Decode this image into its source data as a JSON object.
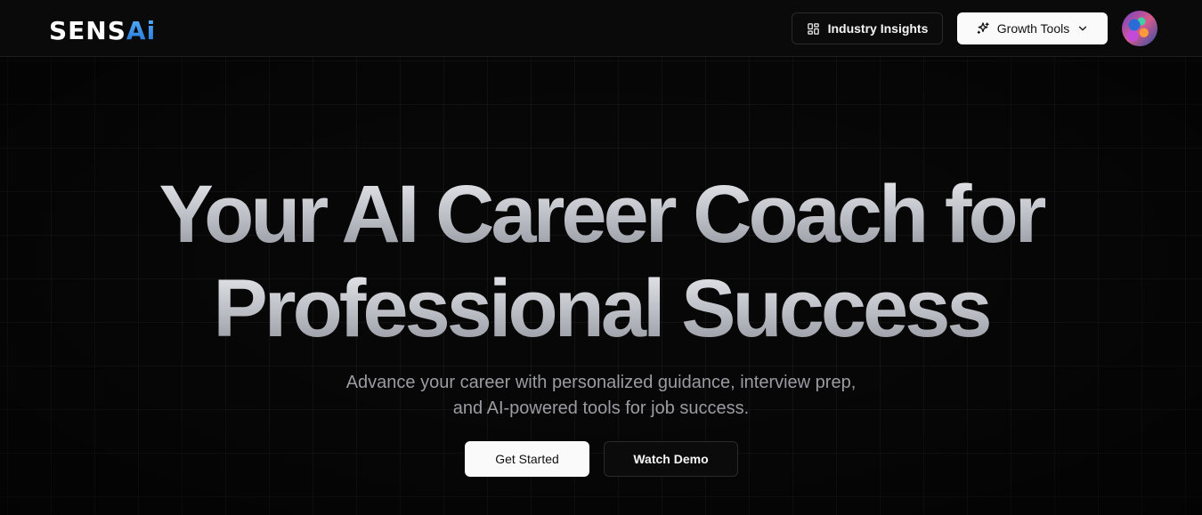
{
  "header": {
    "logo": {
      "text_white": "SENS",
      "text_blue": "Ai"
    },
    "insights_button": {
      "label": "Industry Insights",
      "icon": "layout-dashboard-icon"
    },
    "growth_button": {
      "label": "Growth Tools",
      "icon": "sparkles-icon",
      "chevron_icon": "chevron-down-icon"
    },
    "avatar": {
      "icon": "user-avatar"
    }
  },
  "hero": {
    "headline_line1": "Your AI Career Coach for",
    "headline_line2": "Professional Success",
    "subtitle": "Advance your career with personalized guidance, interview prep, and AI-powered tools for job success.",
    "primary_button": "Get Started",
    "secondary_button": "Watch Demo"
  },
  "colors": {
    "background": "#050505",
    "logo_accent": "#3b8ef0",
    "headline_gradient_top": "#eeeff2",
    "headline_gradient_bottom": "#8d9098",
    "subtitle": "#9b9ba2"
  }
}
